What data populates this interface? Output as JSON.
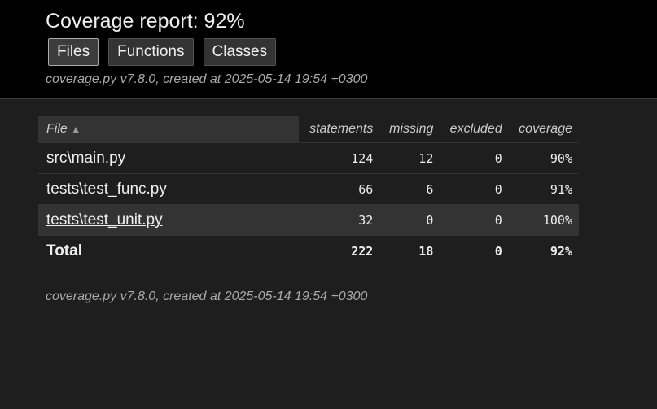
{
  "header": {
    "title": "Coverage report: 92%",
    "tabs": [
      {
        "label": "Files",
        "current": true
      },
      {
        "label": "Functions",
        "current": false
      },
      {
        "label": "Classes",
        "current": false
      }
    ],
    "meta": "coverage.py v7.8.0, created at 2025-05-14 19:54 +0300"
  },
  "table": {
    "columns": [
      "File",
      "statements",
      "missing",
      "excluded",
      "coverage"
    ],
    "sort_icon": "▲",
    "rows": [
      {
        "file": "src\\main.py",
        "statements": "124",
        "missing": "12",
        "excluded": "0",
        "coverage": "90%"
      },
      {
        "file": "tests\\test_func.py",
        "statements": "66",
        "missing": "6",
        "excluded": "0",
        "coverage": "91%"
      },
      {
        "file": "tests\\test_unit.py",
        "statements": "32",
        "missing": "0",
        "excluded": "0",
        "coverage": "100%"
      }
    ],
    "total": {
      "label": "Total",
      "statements": "222",
      "missing": "18",
      "excluded": "0",
      "coverage": "92%"
    }
  },
  "footer": {
    "meta": "coverage.py v7.8.0, created at 2025-05-14 19:54 +0300"
  }
}
